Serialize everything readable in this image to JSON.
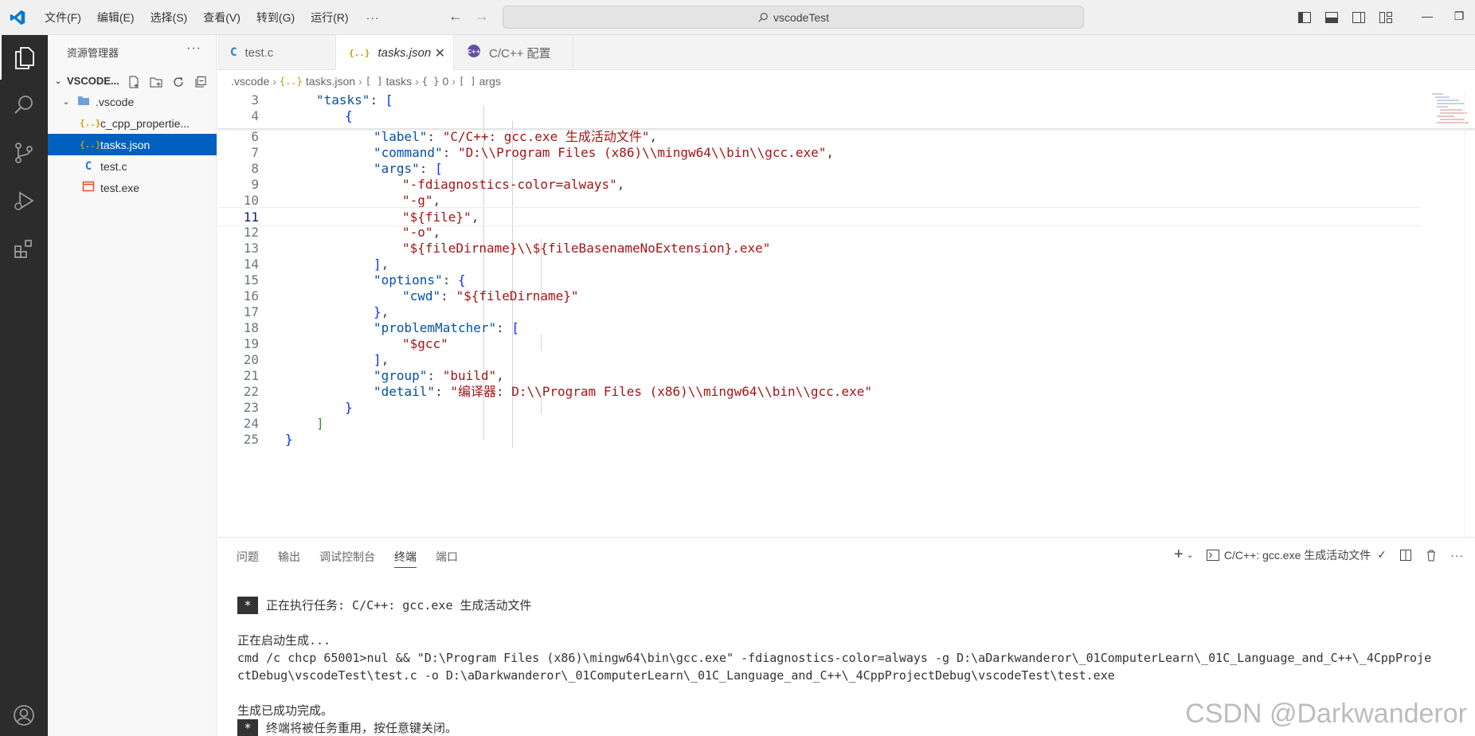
{
  "titlebar": {
    "menus": [
      "文件(F)",
      "编辑(E)",
      "选择(S)",
      "查看(V)",
      "转到(G)",
      "运行(R)"
    ],
    "more": "···",
    "search_text": "vscodeTest"
  },
  "sidebar": {
    "title": "资源管理器",
    "more": "···",
    "items": [
      {
        "label": "VSCODE...",
        "icon": "chevron-down-icon"
      },
      {
        "label": ".vscode",
        "icon": "folder-vscode-icon"
      },
      {
        "label": "c_cpp_propertie...",
        "icon": "json-file-icon",
        "icon_text": "{..}"
      },
      {
        "label": "tasks.json",
        "icon": "json-file-icon",
        "icon_text": "{..}"
      },
      {
        "label": "test.c",
        "icon": "c-file-icon",
        "icon_text": "C"
      },
      {
        "label": "test.exe",
        "icon": "exe-file-icon"
      }
    ]
  },
  "tabs": [
    {
      "label": "test.c",
      "icon_text": "C"
    },
    {
      "label": "tasks.json",
      "icon_text": "{..}",
      "close": "✕"
    },
    {
      "label": "C/C++ 配置"
    }
  ],
  "breadcrumb": [
    {
      "label": ".vscode"
    },
    {
      "label": "tasks.json",
      "icon_text": "{..}"
    },
    {
      "label": "tasks",
      "icon_text": "[ ]"
    },
    {
      "label": "0",
      "icon_text": "{ }"
    },
    {
      "label": "args",
      "icon_text": "[ ]"
    }
  ],
  "editor": {
    "current_line": "11",
    "lines": [
      {
        "n": "3",
        "text": "\"tasks\": ["
      },
      {
        "n": "4",
        "text": "{"
      },
      {
        "n": "6",
        "text": "\"label\": \"C/C++: gcc.exe 生成活动文件\","
      },
      {
        "n": "7",
        "text": "\"command\": \"D:\\\\Program Files (x86)\\\\mingw64\\\\bin\\\\gcc.exe\","
      },
      {
        "n": "8",
        "text": "\"args\": ["
      },
      {
        "n": "9",
        "text": "\"-fdiagnostics-color=always\","
      },
      {
        "n": "10",
        "text": "\"-g\","
      },
      {
        "n": "11",
        "text": "\"${file}\","
      },
      {
        "n": "12",
        "text": "\"-o\","
      },
      {
        "n": "13",
        "text": "\"${fileDirname}\\\\${fileBasenameNoExtension}.exe\""
      },
      {
        "n": "14",
        "text": "],"
      },
      {
        "n": "15",
        "text": "\"options\": {"
      },
      {
        "n": "16",
        "text": "\"cwd\": \"${fileDirname}\""
      },
      {
        "n": "17",
        "text": "},"
      },
      {
        "n": "18",
        "text": "\"problemMatcher\": ["
      },
      {
        "n": "19",
        "text": "\"$gcc\""
      },
      {
        "n": "20",
        "text": "],"
      },
      {
        "n": "21",
        "text": "\"group\": \"build\","
      },
      {
        "n": "22",
        "text": "\"detail\": \"编译器: D:\\\\Program Files (x86)\\\\mingw64\\\\bin\\\\gcc.exe\""
      },
      {
        "n": "23",
        "text": "}"
      },
      {
        "n": "24",
        "text": "]"
      },
      {
        "n": "25",
        "text": "}"
      }
    ]
  },
  "panel": {
    "tabs": [
      "问题",
      "输出",
      "调试控制台",
      "终端",
      "端口"
    ],
    "active_tab": "终端",
    "terminal_name": "C/C++: gcc.exe 生成活动文件",
    "terminal_lines": [
      {
        "star": "*",
        "text": "正在执行任务: C/C++: gcc.exe 生成活动文件"
      },
      {
        "text": ""
      },
      {
        "text": "正在启动生成..."
      },
      {
        "text": "cmd /c chcp 65001>nul && \"D:\\Program Files (x86)\\mingw64\\bin\\gcc.exe\" -fdiagnostics-color=always -g D:\\aDarkwanderor\\_01ComputerLearn\\_01C_Language_and_C++\\_4CppProje"
      },
      {
        "text": "ctDebug\\vscodeTest\\test.c -o D:\\aDarkwanderor\\_01ComputerLearn\\_01C_Language_and_C++\\_4CppProjectDebug\\vscodeTest\\test.exe"
      },
      {
        "text": ""
      },
      {
        "text": "生成已成功完成。"
      },
      {
        "star": "*",
        "text": "终端将被任务重用，按任意键关闭。"
      }
    ]
  },
  "watermark": "CSDN @Darkwanderor",
  "colors": {
    "accent": "#0060c0",
    "activity_bar": "#2c2c2c",
    "key": "#0451a5",
    "string": "#a31515"
  }
}
